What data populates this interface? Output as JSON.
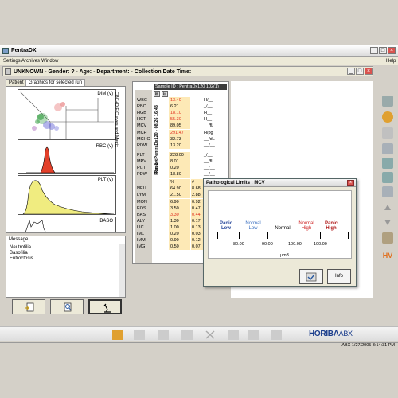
{
  "window": {
    "title": "PentraDX",
    "help": "Help"
  },
  "menu": [
    "Settings",
    "Archives",
    "Window"
  ],
  "patient_header": "UNKNOWN - Gender: ? - Age: - Department: - Collection Date Time:",
  "tabs": [
    "Patient",
    "Graphics for selected run"
  ],
  "plots": {
    "dim": "DIM (v)",
    "rbc": "RBC (v)",
    "plt": "PLT (v)",
    "baso": "BASO",
    "side_label": "CBC+DIF Curves and Matrix"
  },
  "message": {
    "label": "Message",
    "items": [
      "Neutrofilia",
      "Basofilia",
      "Eritroctosis"
    ]
  },
  "sample": {
    "id": "Sample ID : PentraDx120 102(1)",
    "report": "Report",
    "run": "Run 1 - PentraDx120 - 08/26 16:43",
    "rows": [
      {
        "n": "WBC",
        "v": "13.40",
        "u": "H/__",
        "red": true
      },
      {
        "n": "RBC",
        "v": "6.21",
        "u": "_/__"
      },
      {
        "n": "HGB",
        "v": "18.10",
        "u": "H__",
        "red": true
      },
      {
        "n": "HCT",
        "v": "55.30",
        "u": "H__",
        "red": true
      },
      {
        "n": "MCV",
        "v": "89.05",
        "u": "__/fL"
      },
      {
        "n": "MCH",
        "v": "291.47",
        "u": "H/pg",
        "red": true
      },
      {
        "n": "MCHC",
        "v": "32.73",
        "u": "__/dL"
      },
      {
        "n": "RDW",
        "v": "13.20",
        "u": "__/__"
      },
      {
        "n": "PLT",
        "v": "228.00",
        "u": "_/__"
      },
      {
        "n": "MPV",
        "v": "8.01",
        "u": "__/fL"
      },
      {
        "n": "PCT",
        "v": "0.20",
        "u": "__/__"
      },
      {
        "n": "PDW",
        "v": "18.80",
        "u": "__/__"
      },
      {
        "n": "",
        "v": "%",
        "v2": "#",
        "u": ""
      },
      {
        "n": "NEU",
        "v": "64.90",
        "v2": "8.68",
        "u": ""
      },
      {
        "n": "LYM",
        "v": "21.50",
        "v2": "2.88",
        "u": ""
      },
      {
        "n": "MON",
        "v": "6.90",
        "v2": "0.92",
        "u": ""
      },
      {
        "n": "EOS",
        "v": "3.50",
        "v2": "0.47",
        "u": ""
      },
      {
        "n": "BAS",
        "v": "3.30",
        "v2": "0.44",
        "u": "",
        "red": true
      },
      {
        "n": "ALY",
        "v": "1.30",
        "v2": "0.17",
        "u": ""
      },
      {
        "n": "LIC",
        "v": "1.00",
        "v2": "0.13",
        "u": ""
      },
      {
        "n": "IML",
        "v": "0.20",
        "v2": "0.03",
        "u": ""
      },
      {
        "n": "IMM",
        "v": "0.90",
        "v2": "0.12",
        "u": ""
      },
      {
        "n": "IMG",
        "v": "0.50",
        "v2": "0.07",
        "u": ""
      }
    ]
  },
  "dialog": {
    "title": "Pathological Limits : MCV",
    "zones": [
      {
        "label": "Panic Low",
        "color": "#2b4a9c"
      },
      {
        "label": "Normal Low",
        "color": "#3a6fc0"
      },
      {
        "label": "Normal",
        "color": "#000000"
      },
      {
        "label": "Normal High",
        "color": "#d02828"
      },
      {
        "label": "Panic High",
        "color": "#b01818"
      }
    ],
    "ticks": [
      "80.00",
      "90.00",
      "100.00",
      "100.00"
    ],
    "unit": "µm3",
    "ok_label": "",
    "info_label": "Info"
  },
  "logo": {
    "brand": "HORIBA",
    "sub": "ABX"
  },
  "status": "ABX  1/27/2005  3:14:31 PM"
}
